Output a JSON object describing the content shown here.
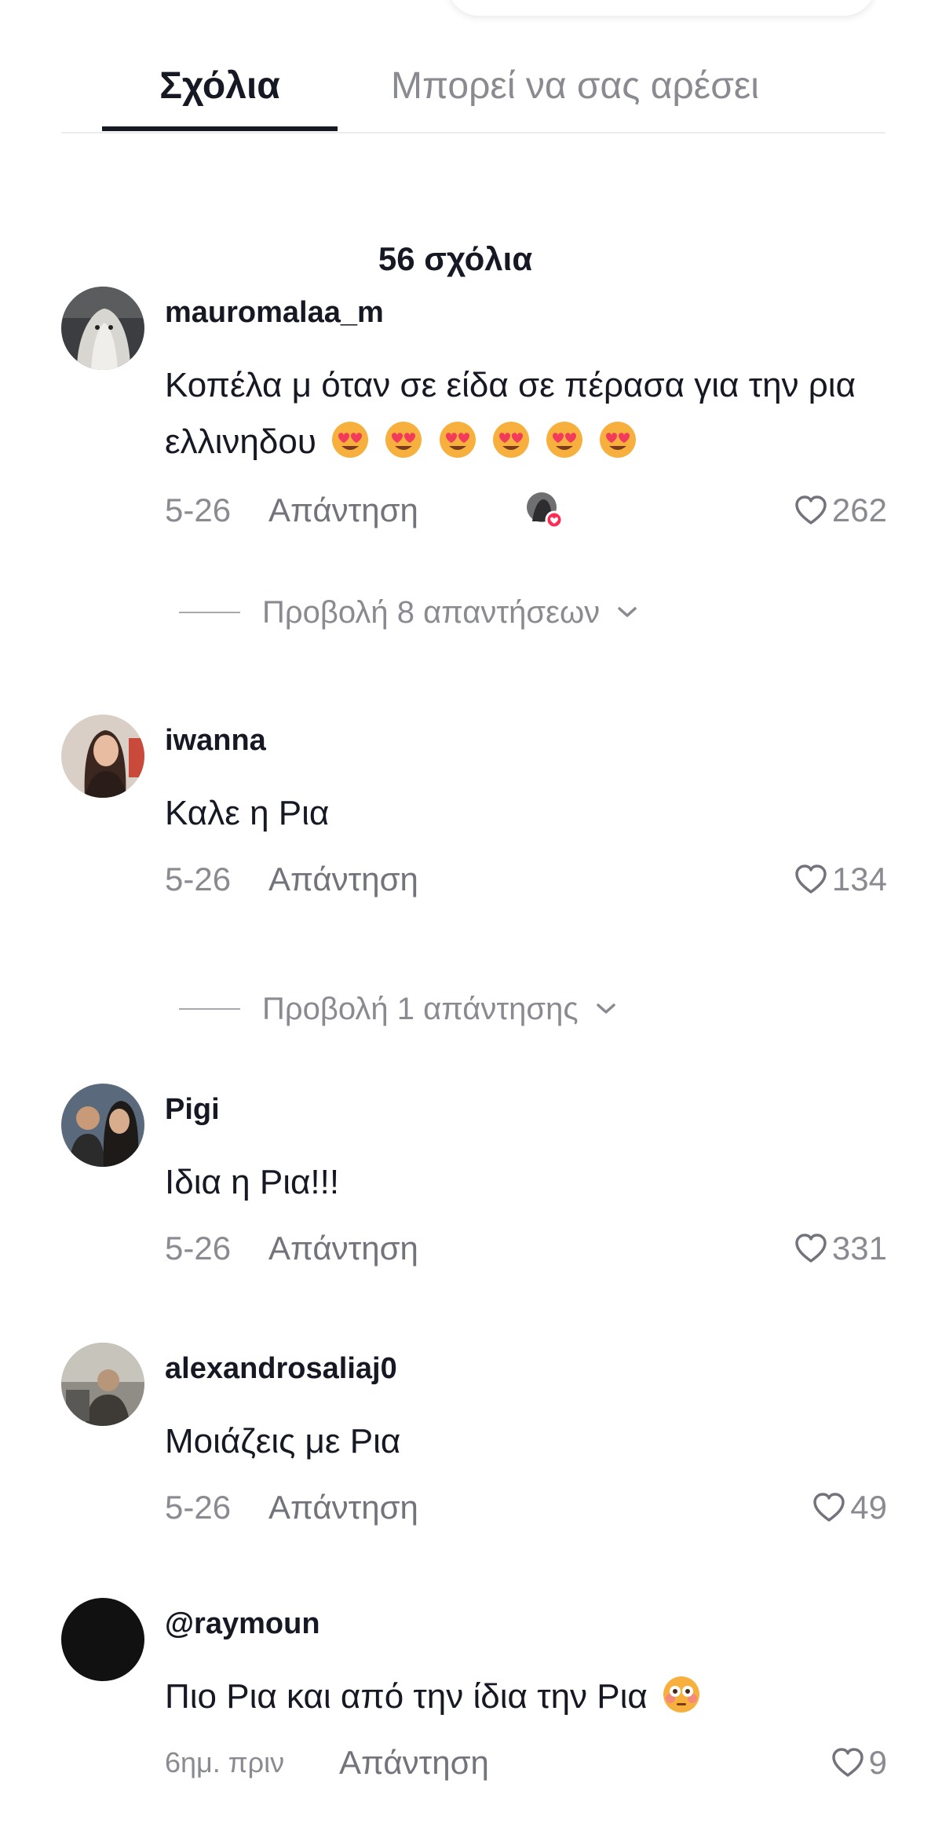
{
  "tabs": {
    "comments_label": "Σχόλια",
    "may_like_label": "Μπορεί να σας αρέσει"
  },
  "comment_count_label": "56 σχόλια",
  "reply_label": "Απάντηση",
  "comments": [
    {
      "username": "mauromalaa_m",
      "text": "Κοπέλα μ όταν σε είδα σε πέρασα για την ρια ελλινηδου",
      "emojis": [
        "heart-eyes",
        "heart-eyes",
        "heart-eyes",
        "heart-eyes",
        "heart-eyes",
        "heart-eyes"
      ],
      "date": "5-26",
      "likes": "262",
      "creator_liked": true,
      "view_replies": "Προβολή 8 απαντήσεων"
    },
    {
      "username": "iwanna",
      "text": "Καλε η Ρια",
      "date": "5-26",
      "likes": "134",
      "view_replies": "Προβολή 1 απάντησης"
    },
    {
      "username": "Pigi",
      "text": "Ιδια η Ρια!!!",
      "date": "5-26",
      "likes": "331"
    },
    {
      "username": "alexandrosaliaj0",
      "text": "Μοιάζεις με Ρια",
      "date": "5-26",
      "likes": "49"
    },
    {
      "username": "@raymoun",
      "text": "Πιο Ρια και από την ίδια την Ρια",
      "emojis": [
        "flushed"
      ],
      "date": "6ημ. πριν",
      "likes": "9"
    }
  ],
  "colors": {
    "text_primary": "#161823",
    "text_secondary": "#8a8b91",
    "divider": "#ececec",
    "creator_badge": "#fe2c55"
  }
}
